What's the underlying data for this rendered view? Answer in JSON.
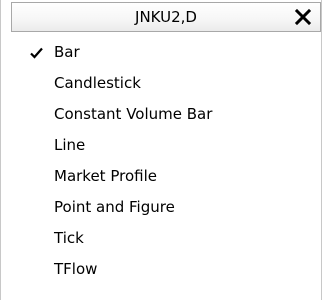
{
  "menu": {
    "title": "JNKU2,D",
    "close_icon": "close-icon",
    "items": [
      {
        "label": "Bar",
        "checked": true
      },
      {
        "label": "Candlestick",
        "checked": false
      },
      {
        "label": "Constant Volume Bar",
        "checked": false
      },
      {
        "label": "Line",
        "checked": false
      },
      {
        "label": "Market Profile",
        "checked": false
      },
      {
        "label": "Point and Figure",
        "checked": false
      },
      {
        "label": "Tick",
        "checked": false
      },
      {
        "label": "TFlow",
        "checked": false
      }
    ]
  }
}
